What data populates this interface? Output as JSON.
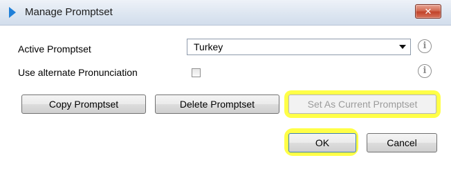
{
  "window": {
    "title": "Manage Promptset",
    "close_glyph": "✕",
    "app_icon": "blue-chevron-icon"
  },
  "form": {
    "active_promptset_label": "Active Promptset",
    "active_promptset_value": "Turkey",
    "alternate_pronunciation_label": "Use alternate Pronunciation",
    "alternate_pronunciation_checked": false,
    "info_glyph": "i"
  },
  "actions": {
    "copy_label": "Copy Promptset",
    "delete_label": "Delete Promptset",
    "set_current_label": "Set As Current Promptset"
  },
  "footer": {
    "ok_label": "OK",
    "cancel_label": "Cancel"
  },
  "colors": {
    "highlight": "#ffff00",
    "titlebar": "#dde6f1",
    "close_button": "#c1432a",
    "icon_blue": "#1f7fd8"
  }
}
